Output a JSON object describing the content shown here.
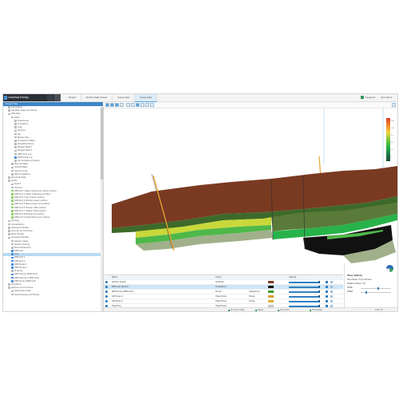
{
  "app": {
    "title": "Leapfrog Energy",
    "tabs": [
      {
        "label": "Project"
      },
      {
        "label": "Surface Data Viewer"
      },
      {
        "label": "Scene View"
      },
      {
        "label": "Scene View"
      }
    ],
    "account": "Seequent",
    "user": "User Name"
  },
  "project_tree": {
    "header": "Project Tree",
    "items": [
      {
        "label": "Topography",
        "indent": 1
      },
      {
        "label": "GIS Data, Maps and Photos",
        "indent": 1
      },
      {
        "label": "Well Data",
        "indent": 1
      },
      {
        "label": "Wells",
        "indent": 2
      },
      {
        "label": "Trajectories",
        "indent": 3
      },
      {
        "label": "Formations",
        "indent": 3
      },
      {
        "label": "Logs",
        "indent": 3
      },
      {
        "label": "Sections",
        "indent": 3
      },
      {
        "label": "GR",
        "indent": 3
      },
      {
        "label": "Marker Tops",
        "indent": 3
      },
      {
        "label": "Formations Tables",
        "indent": 3
      },
      {
        "label": "Simplified Facies",
        "indent": 3
      },
      {
        "label": "Merged Table 1",
        "indent": 3
      },
      {
        "label": "Merged Table 2",
        "indent": 3
      },
      {
        "label": "RMS Zone Log",
        "indent": 3
      },
      {
        "label": "RMS Facies Log",
        "indent": 3
      },
      {
        "label": "GR_Sandstone_Fraction",
        "indent": 3
      },
      {
        "label": "Planned Wells",
        "indent": 2
      },
      {
        "label": "Interval Maps",
        "indent": 2
      },
      {
        "label": "Seismic Lines",
        "indent": 2
      },
      {
        "label": "Well Correlations",
        "indent": 2
      },
      {
        "label": "Structural Data",
        "indent": 1
      },
      {
        "label": "Faults",
        "indent": 1
      },
      {
        "label": "Fault 1",
        "indent": 2
      },
      {
        "label": "Horizons",
        "indent": 2
      },
      {
        "label": "RMS Surf 1 Base Cretaceous (other) surface",
        "indent": 2
      },
      {
        "label": "RMS Surf 2 Upper Cretaceous surface",
        "indent": 2
      },
      {
        "label": "RMS Surf 3 Top Jurassic surface",
        "indent": 2
      },
      {
        "label": "RMS Surf 4 Middle Jurassic surface",
        "indent": 2
      },
      {
        "label": "RMS Surf 5 Base Jurassic (J1) surface",
        "indent": 2
      },
      {
        "label": "RMS Surf 6 Triassic (TR2) surface",
        "indent": 2
      },
      {
        "label": "RMS Surf 7 Triassic (TR1) surface",
        "indent": 2
      },
      {
        "label": "RMS Surf 8 Permian (P) surface",
        "indent": 2
      },
      {
        "label": "RMS Surf 9 Carboniferous (C) surface",
        "indent": 2
      },
      {
        "label": "Geology",
        "indent": 1
      },
      {
        "label": "Interpretation",
        "indent": 1
      },
      {
        "label": "Geological Models",
        "indent": 1
      },
      {
        "label": "Volumes and Surfaces",
        "indent": 1
      },
      {
        "label": "Block Models",
        "indent": 1
      },
      {
        "label": "Geological Models",
        "indent": 1
      },
      {
        "label": "Seismic Cubes",
        "indent": 2
      },
      {
        "label": "Seismic Velocity",
        "indent": 2
      },
      {
        "label": "Block Model Grid",
        "indent": 2
      },
      {
        "label": "RMS Grid",
        "indent": 2
      },
      {
        "label": "Grid",
        "indent": 2
      },
      {
        "label": "RMS Grid 1",
        "indent": 2
      },
      {
        "label": "RMS Grid 2",
        "indent": 2
      },
      {
        "label": "RMS Facies 1",
        "indent": 2
      },
      {
        "label": "RMS Facies 2",
        "indent": 2
      },
      {
        "label": "Property",
        "indent": 2
      },
      {
        "label": "RMS Volume (RMS Grid)",
        "indent": 2
      },
      {
        "label": "RMS Volume 2 (RMS Grid)",
        "indent": 2
      },
      {
        "label": "RMS Zones (RMS Grid)",
        "indent": 2
      },
      {
        "label": "Simulation",
        "indent": 1
      },
      {
        "label": "Sections and Contours",
        "indent": 1
      },
      {
        "label": "Exploration Data",
        "indent": 2
      },
      {
        "label": "Saved Scenes and Movies",
        "indent": 2
      }
    ],
    "selected_index": 44
  },
  "properties": {
    "header": {
      "name": "Name",
      "colour": "Colour",
      "opacity": "Opacity"
    },
    "rows": [
      {
        "name": "Section Scaled",
        "style": "Surfaces",
        "legend": "",
        "color": "#7a3a22",
        "opacity": 0.92
      },
      {
        "name": "RMS Grid (Sliced)",
        "style": "Formations",
        "legend": "",
        "color": "#111111",
        "opacity": 0.92,
        "selected": true
      },
      {
        "name": "RMS Zones (RMS Grid)",
        "style": "Zones",
        "legend": "Categorical",
        "color": "#3a9a2a",
        "opacity": 0.92
      },
      {
        "name": "GR Facies 1",
        "style": "Trajectories",
        "legend": "Facies",
        "color": "#d89a2a",
        "opacity": 0.92
      },
      {
        "name": "GR Facies 2",
        "style": "Trajectories",
        "legend": "Facies",
        "color": "#d8b02a",
        "opacity": 0.92
      },
      {
        "name": "Trajectory",
        "style": "Trajectories",
        "legend": "",
        "color": "#c8c8c8",
        "opacity": 0.92
      }
    ]
  },
  "slicer": {
    "title": "Slicer Options",
    "mode_label": "Slice Mode",
    "mode_value": "From Camera",
    "distance_label": "Distance Plane",
    "distance_value": "Far",
    "width_label": "Width",
    "width_value": 0.55,
    "offset_label": "Offset",
    "offset_value": 0.15
  },
  "colorbar": {
    "ticks": [
      "150",
      "120",
      "90",
      "60",
      "30",
      "0"
    ],
    "colors": [
      "#e03a2a",
      "#f08a2a",
      "#f4d23a",
      "#7ac83a",
      "#27b34a",
      "#1e7a4a",
      "#1a4f3a"
    ]
  },
  "status": {
    "items": [
      "No Colour Scale",
      "Ready",
      "Full screen",
      "Frame Rate"
    ],
    "code": "Code: 45"
  }
}
